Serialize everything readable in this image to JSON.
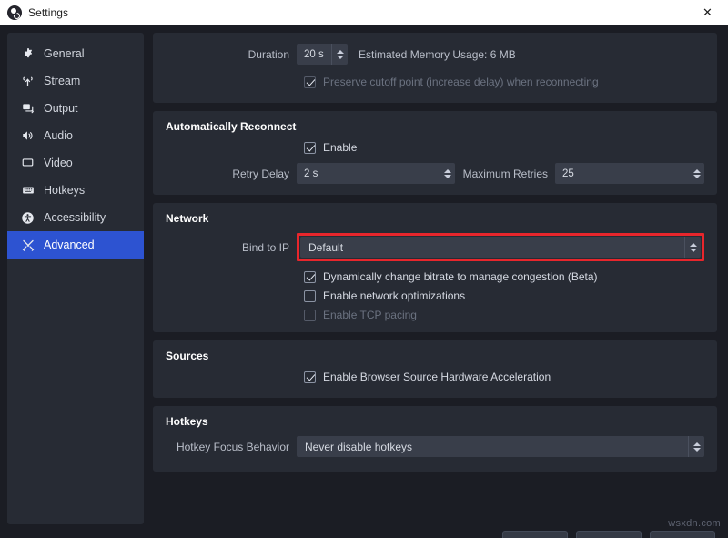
{
  "window": {
    "title": "Settings",
    "app_icon": "obs-logo-icon",
    "close_label": "✕"
  },
  "sidebar": {
    "items": [
      {
        "label": "General",
        "icon": "gear-icon",
        "selected": false
      },
      {
        "label": "Stream",
        "icon": "broadcast-icon",
        "selected": false
      },
      {
        "label": "Output",
        "icon": "output-screen-icon",
        "selected": false
      },
      {
        "label": "Audio",
        "icon": "speaker-icon",
        "selected": false
      },
      {
        "label": "Video",
        "icon": "monitor-icon",
        "selected": false
      },
      {
        "label": "Hotkeys",
        "icon": "keyboard-icon",
        "selected": false
      },
      {
        "label": "Accessibility",
        "icon": "accessibility-icon",
        "selected": false
      },
      {
        "label": "Advanced",
        "icon": "tools-icon",
        "selected": true
      }
    ]
  },
  "content": {
    "delay_group": {
      "duration_label": "Duration",
      "duration_value": "20 s",
      "memory_usage_text": "Estimated Memory Usage: 6 MB",
      "preserve_cutoff_label": "Preserve cutoff point (increase delay) when reconnecting",
      "preserve_cutoff_checked": true,
      "preserve_cutoff_disabled": true
    },
    "reconnect_group": {
      "title": "Automatically Reconnect",
      "enable_label": "Enable",
      "enable_checked": true,
      "retry_delay_label": "Retry Delay",
      "retry_delay_value": "2 s",
      "max_retries_label": "Maximum Retries",
      "max_retries_value": "25"
    },
    "network_group": {
      "title": "Network",
      "bind_ip_label": "Bind to IP",
      "bind_ip_value": "Default",
      "bind_ip_highlight_color": "#e8262c",
      "dynamic_bitrate_label": "Dynamically change bitrate to manage congestion (Beta)",
      "dynamic_bitrate_checked": true,
      "network_opt_label": "Enable network optimizations",
      "network_opt_checked": false,
      "tcp_pacing_label": "Enable TCP pacing",
      "tcp_pacing_checked": false,
      "tcp_pacing_disabled": true
    },
    "sources_group": {
      "title": "Sources",
      "browser_hw_label": "Enable Browser Source Hardware Acceleration",
      "browser_hw_checked": true
    },
    "hotkeys_group": {
      "title": "Hotkeys",
      "focus_behavior_label": "Hotkey Focus Behavior",
      "focus_behavior_value": "Never disable hotkeys"
    }
  },
  "footer": {
    "watermark": "wsxdn.com"
  }
}
